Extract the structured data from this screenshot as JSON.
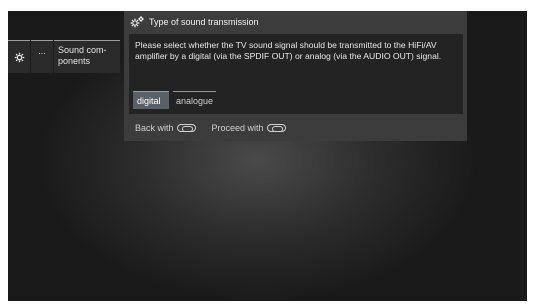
{
  "breadcrumb": {
    "gear_icon": "gear-icon",
    "dots": "...",
    "sound_components": "Sound com-\nponents"
  },
  "dialog": {
    "title": "Type of sound transmission",
    "title_icon": "gears-icon",
    "message": "Please select whether the TV sound signal should be transmitted to the HiFi/AV amplifier by a digital (via the SPDIF OUT) or analog (via the AUDIO OUT) signal.",
    "options": [
      {
        "label": "digital",
        "selected": true
      },
      {
        "label": "analogue",
        "selected": false
      }
    ],
    "footer": {
      "back_label": "Back with",
      "back_icon": "back-button-icon",
      "proceed_label": "Proceed with",
      "proceed_icon": "ok-button-icon"
    }
  }
}
